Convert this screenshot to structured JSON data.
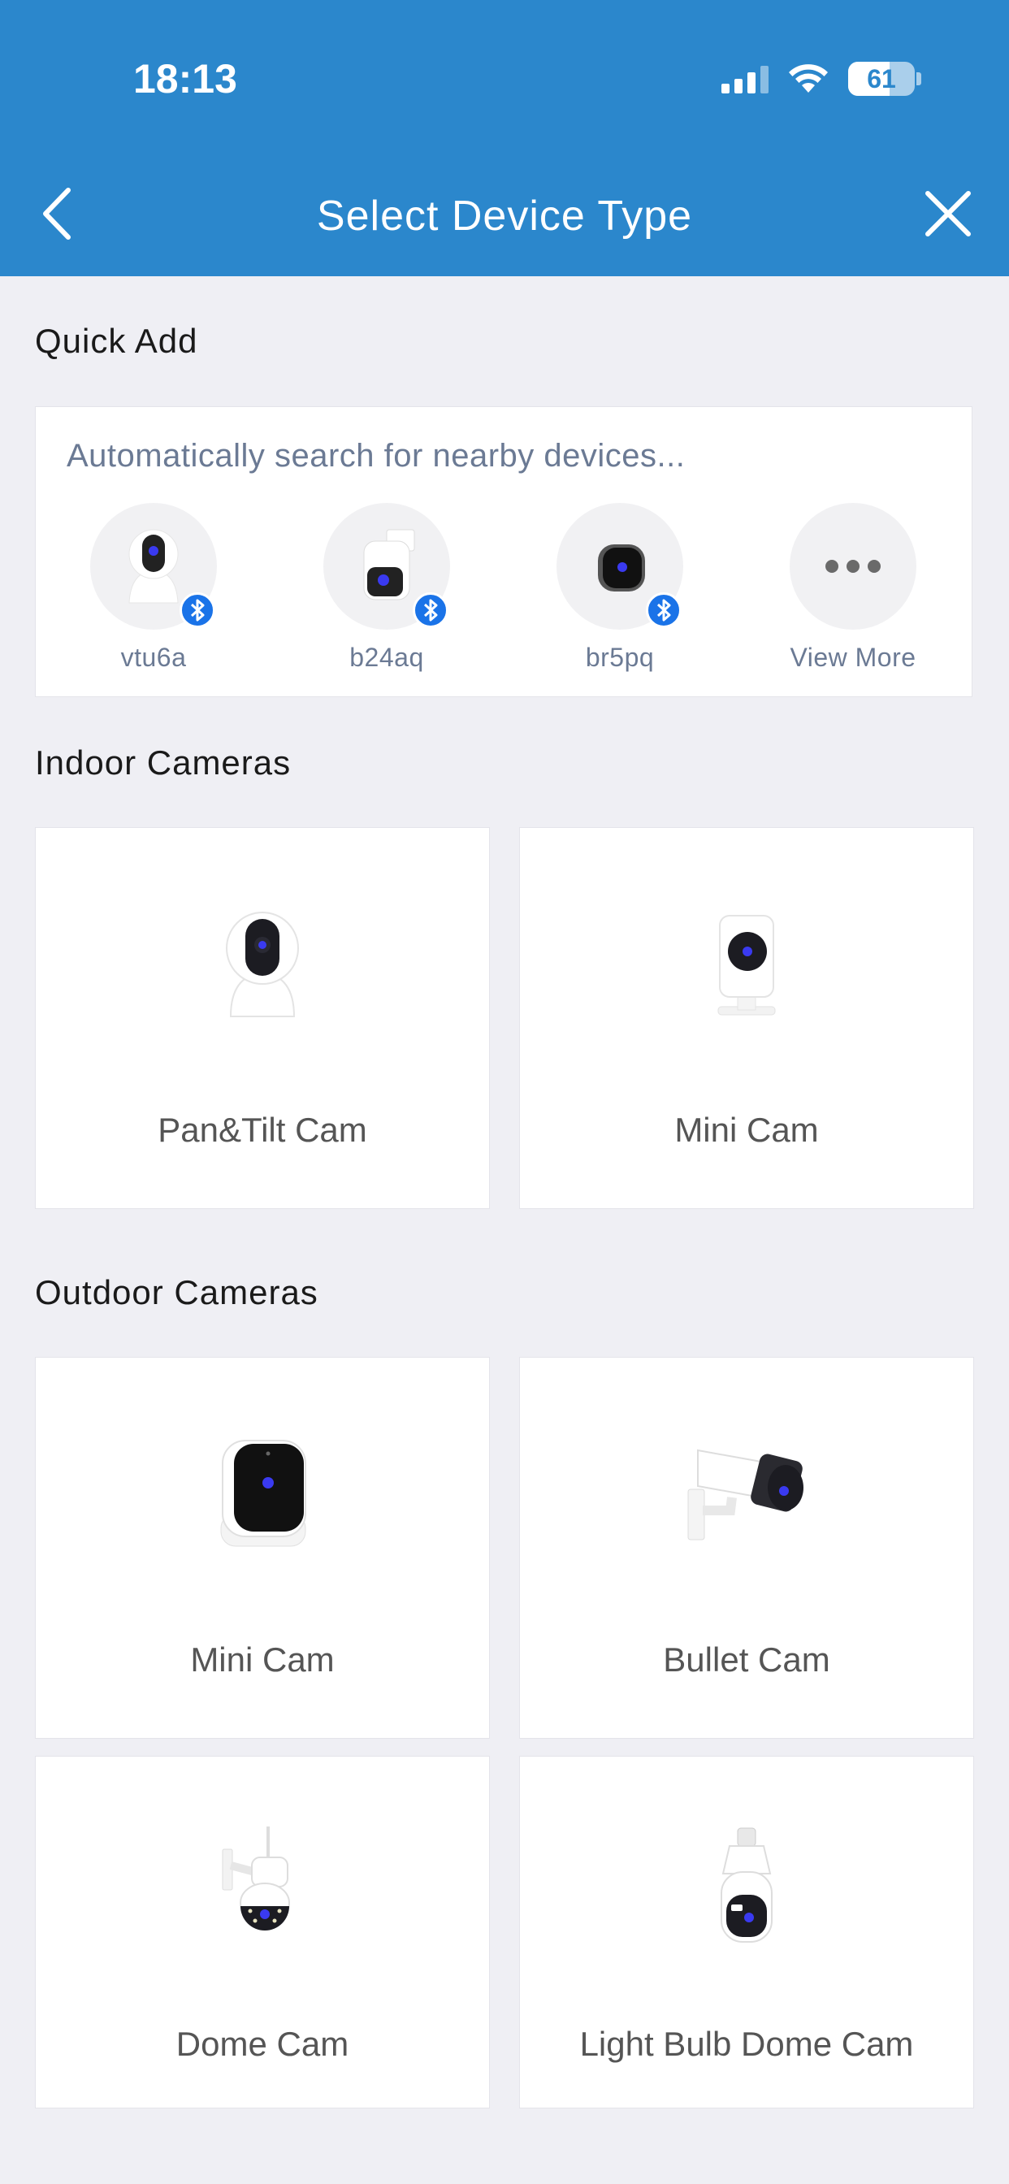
{
  "status_bar": {
    "time": "18:13",
    "battery": "61"
  },
  "nav": {
    "title": "Select Device Type"
  },
  "quick_add": {
    "title": "Quick Add",
    "hint": "Automatically search for nearby devices...",
    "items": [
      {
        "label": "vtu6a"
      },
      {
        "label": "b24aq"
      },
      {
        "label": "br5pq"
      },
      {
        "label": "View More"
      }
    ]
  },
  "indoor": {
    "title": "Indoor Cameras",
    "items": [
      {
        "label": "Pan&Tilt Cam"
      },
      {
        "label": "Mini Cam"
      }
    ]
  },
  "outdoor": {
    "title": "Outdoor Cameras",
    "items": [
      {
        "label": "Mini Cam"
      },
      {
        "label": "Bullet Cam"
      },
      {
        "label": "Dome Cam"
      },
      {
        "label": "Light Bulb Dome Cam"
      }
    ]
  },
  "colors": {
    "header": "#2b87cc",
    "bluetooth": "#1a73e8",
    "background": "#efeff4"
  }
}
